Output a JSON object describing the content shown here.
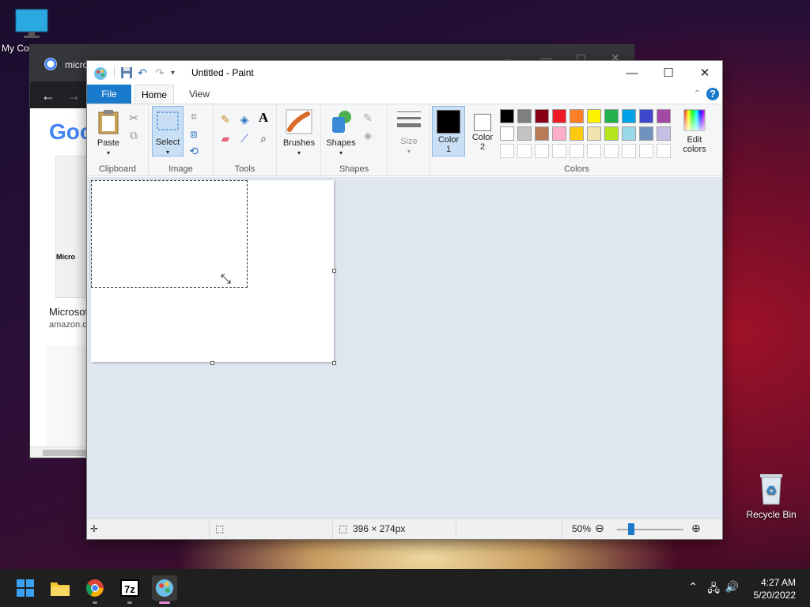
{
  "desktop": {
    "my_computer_label": "My Co",
    "recycle_bin_label": "Recycle Bin"
  },
  "chrome": {
    "tab_title": "micro",
    "google_logo": "Goo",
    "result_title": "Microsof",
    "result_url": "amazon.c",
    "product_text": "Micro"
  },
  "paint": {
    "title": "Untitled - Paint",
    "tabs": {
      "file": "File",
      "home": "Home",
      "view": "View"
    },
    "groups": {
      "clipboard": "Clipboard",
      "image": "Image",
      "tools": "Tools",
      "shapes": "Shapes",
      "colors": "Colors"
    },
    "buttons": {
      "paste": "Paste",
      "select": "Select",
      "brushes": "Brushes",
      "shapes": "Shapes",
      "size": "Size",
      "color1_line1": "Color",
      "color1_line2": "1",
      "color2_line1": "Color",
      "color2_line2": "2",
      "edit_colors_line1": "Edit",
      "edit_colors_line2": "colors"
    },
    "text_tool_glyph": "A",
    "palette_row1": [
      "#000000",
      "#7f7f7f",
      "#880015",
      "#ed1c24",
      "#ff7f27",
      "#fff200",
      "#22b14c",
      "#00a2e8",
      "#3f48cc",
      "#a349a4"
    ],
    "palette_row2": [
      "#ffffff",
      "#c3c3c3",
      "#b97a57",
      "#ffaec9",
      "#ffc90e",
      "#efe4b0",
      "#b5e61d",
      "#99d9ea",
      "#7092be",
      "#c8bfe7"
    ],
    "primary_color": "#000000",
    "secondary_color": "#ffffff",
    "status": {
      "canvas_size": "396 × 274px",
      "zoom": "50%"
    }
  },
  "taskbar": {
    "time": "4:27 AM",
    "date": "5/20/2022",
    "sevenzip_label": "7z"
  }
}
